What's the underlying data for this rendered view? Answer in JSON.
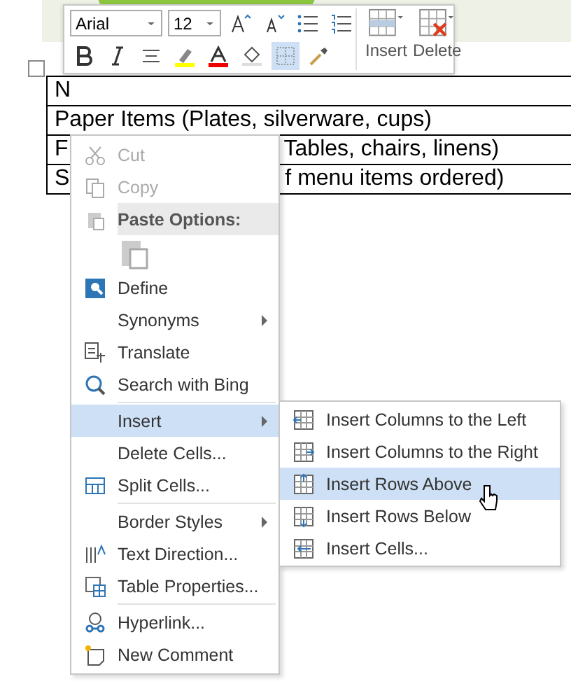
{
  "toolbar": {
    "font": "Arial",
    "size": "12",
    "borders_active": true,
    "buttons": [
      "Insert",
      "Delete"
    ]
  },
  "table": {
    "rows": [
      [
        "N"
      ],
      [
        "Paper Items (Plates, silverware, cups)"
      ],
      [
        "F",
        "Tables, chairs, linens)"
      ],
      [
        "S",
        "f menu items ordered)"
      ]
    ]
  },
  "context_menu": {
    "items": [
      {
        "kind": "command",
        "label": "Cut",
        "disabled": true,
        "selected": false,
        "submenu": false
      },
      {
        "kind": "command",
        "label": "Copy",
        "disabled": true,
        "selected": false,
        "submenu": false
      },
      {
        "kind": "header",
        "label": "Paste Options:"
      },
      {
        "kind": "paste-option"
      },
      {
        "kind": "command",
        "label": "Define",
        "disabled": false,
        "selected": false,
        "submenu": false
      },
      {
        "kind": "command",
        "label": "Synonyms",
        "disabled": false,
        "selected": false,
        "submenu": true
      },
      {
        "kind": "command",
        "label": "Translate",
        "disabled": false,
        "selected": false,
        "submenu": false
      },
      {
        "kind": "command",
        "label": "Search with Bing",
        "disabled": false,
        "selected": false,
        "submenu": false
      },
      {
        "kind": "separator"
      },
      {
        "kind": "command",
        "label": "Insert",
        "disabled": false,
        "selected": true,
        "submenu": true
      },
      {
        "kind": "command",
        "label": "Delete Cells...",
        "disabled": false,
        "selected": false,
        "submenu": false
      },
      {
        "kind": "command",
        "label": "Split Cells...",
        "disabled": false,
        "selected": false,
        "submenu": false
      },
      {
        "kind": "separator"
      },
      {
        "kind": "command",
        "label": "Border Styles",
        "disabled": false,
        "selected": false,
        "submenu": true
      },
      {
        "kind": "command",
        "label": "Text Direction...",
        "disabled": false,
        "selected": false,
        "submenu": false
      },
      {
        "kind": "command",
        "label": "Table Properties...",
        "disabled": false,
        "selected": false,
        "submenu": false
      },
      {
        "kind": "separator"
      },
      {
        "kind": "command",
        "label": "Hyperlink...",
        "disabled": false,
        "selected": false,
        "submenu": false
      },
      {
        "kind": "command",
        "label": "New Comment",
        "disabled": false,
        "selected": false,
        "submenu": false
      }
    ]
  },
  "submenu": {
    "items": [
      {
        "label": "Insert Columns to the Left",
        "selected": false
      },
      {
        "label": "Insert Columns to the Right",
        "selected": false
      },
      {
        "label": "Insert Rows Above",
        "selected": true
      },
      {
        "label": "Insert Rows Below",
        "selected": false
      },
      {
        "label": "Insert Cells...",
        "selected": false
      }
    ]
  }
}
